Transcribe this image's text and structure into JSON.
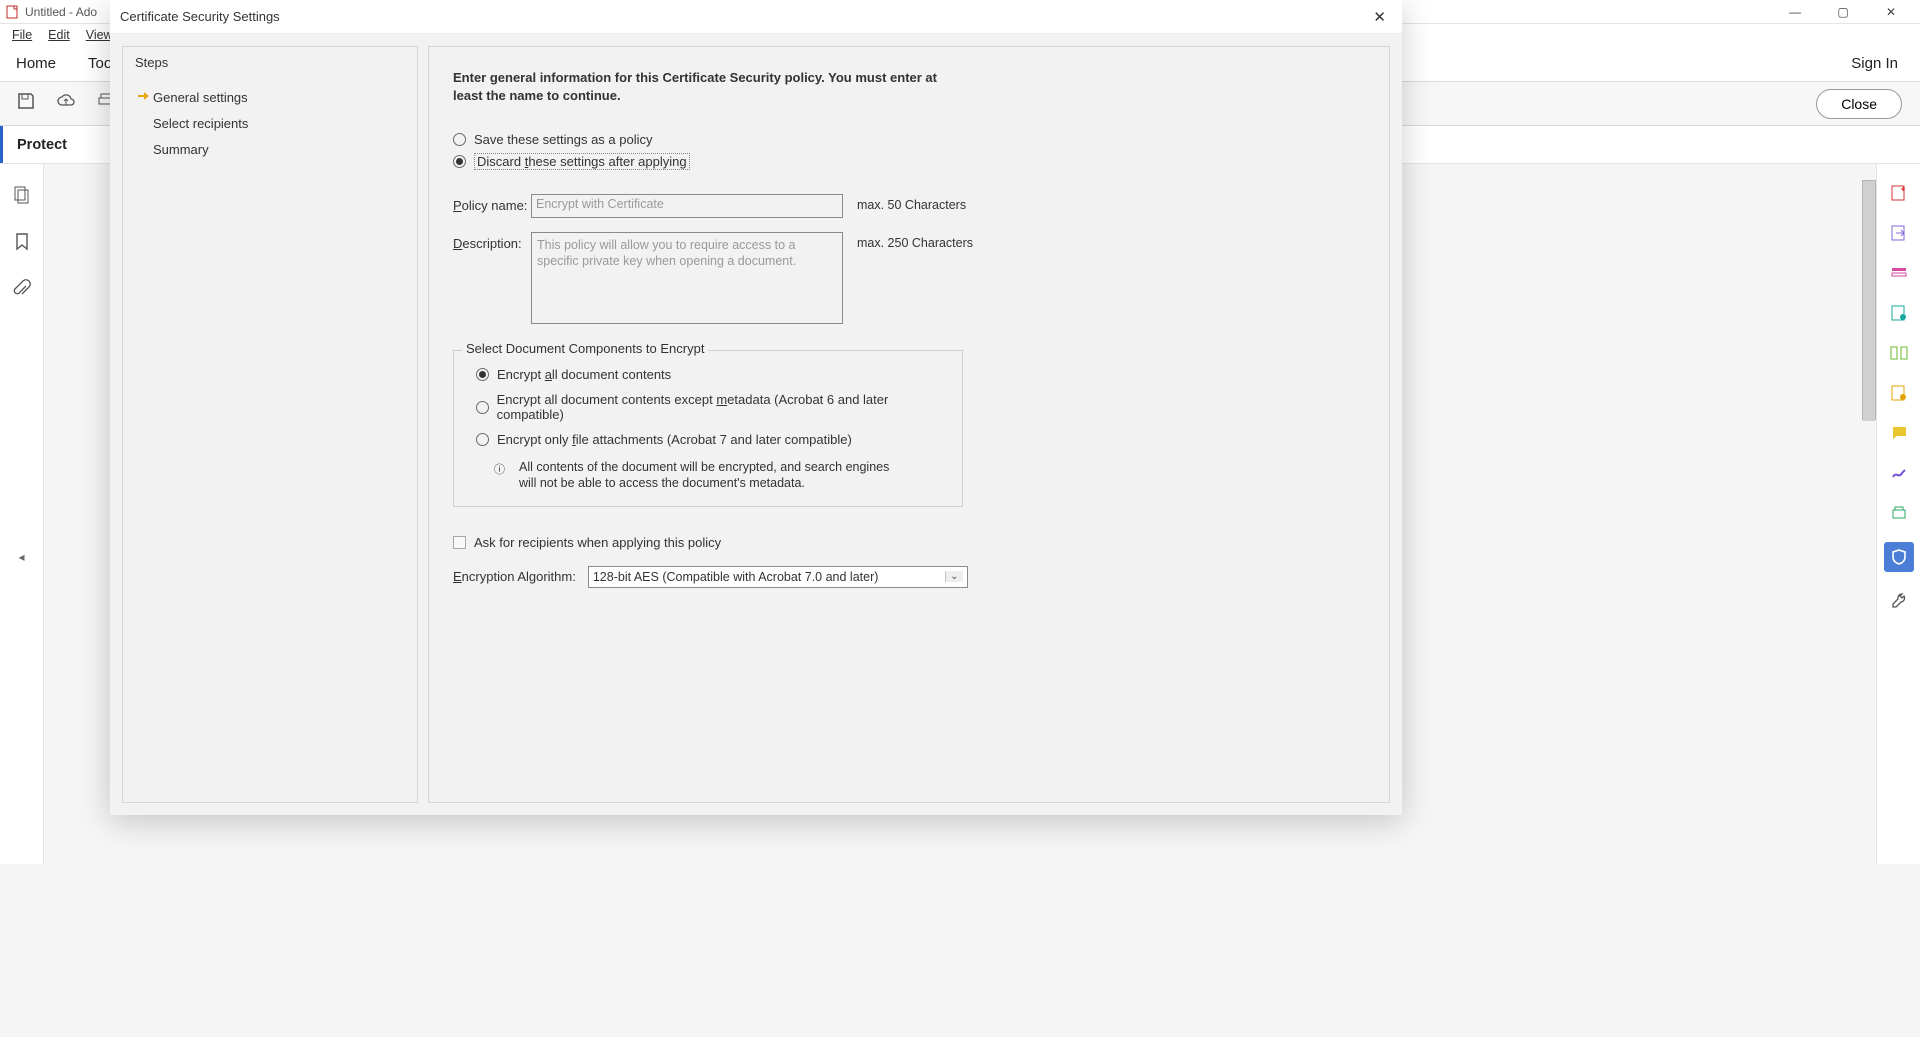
{
  "app": {
    "window_title": "Untitled - Ado",
    "menu": {
      "file": "File",
      "edit": "Edit",
      "view": "View"
    },
    "tabs": {
      "home": "Home",
      "tools": "Too",
      "signin": "Sign In"
    },
    "close_button": "Close",
    "protect_label": "Protect"
  },
  "left_icons": {
    "pages": "pages-icon",
    "bookmark": "bookmark-icon",
    "attach": "attach-icon"
  },
  "right_icons": [
    "create-pdf-icon",
    "export-pdf-icon",
    "organize-icon",
    "edit-pdf-icon",
    "compare-icon",
    "certificates-icon",
    "comment-icon",
    "sign-icon",
    "print-prod-icon",
    "protect-icon",
    "tools-more-icon"
  ],
  "dialog": {
    "title": "Certificate Security Settings",
    "steps_header": "Steps",
    "steps": {
      "general": "General settings",
      "recipients": "Select recipients",
      "summary": "Summary"
    },
    "intro": "Enter general information for this Certificate Security policy. You must enter at least the name to continue.",
    "settings_radio": {
      "save": "Save these settings as a policy",
      "discard_pre": "Discard ",
      "discard_u": "t",
      "discard_post": "hese settings after applying"
    },
    "policy_name": {
      "label_pre": "P",
      "label_post": "olicy name:",
      "value": "Encrypt with Certificate",
      "hint": "max. 50 Characters"
    },
    "description": {
      "label_pre": "D",
      "label_post": "escription:",
      "value": "This policy will allow you to require access to a specific private key when opening a document.",
      "hint": "max. 250 Characters"
    },
    "components": {
      "legend": "Select Document Components to Encrypt",
      "opt1_pre": "Encrypt ",
      "opt1_u": "a",
      "opt1_post": "ll document contents",
      "opt2_pre": "Encrypt all document contents except ",
      "opt2_u": "m",
      "opt2_post": "etadata (Acrobat 6 and later compatible)",
      "opt3_pre": "Encrypt only ",
      "opt3_u": "f",
      "opt3_post": "ile attachments (Acrobat 7 and later compatible)",
      "info": "All contents of the document will be encrypted, and search engines will not be able to access the document's metadata."
    },
    "ask_label": "Ask for recipients when applying this policy",
    "algorithm": {
      "label_pre": "E",
      "label_post": "ncryption Algorithm:",
      "value": "128-bit AES (Compatible with Acrobat 7.0 and later)"
    }
  }
}
